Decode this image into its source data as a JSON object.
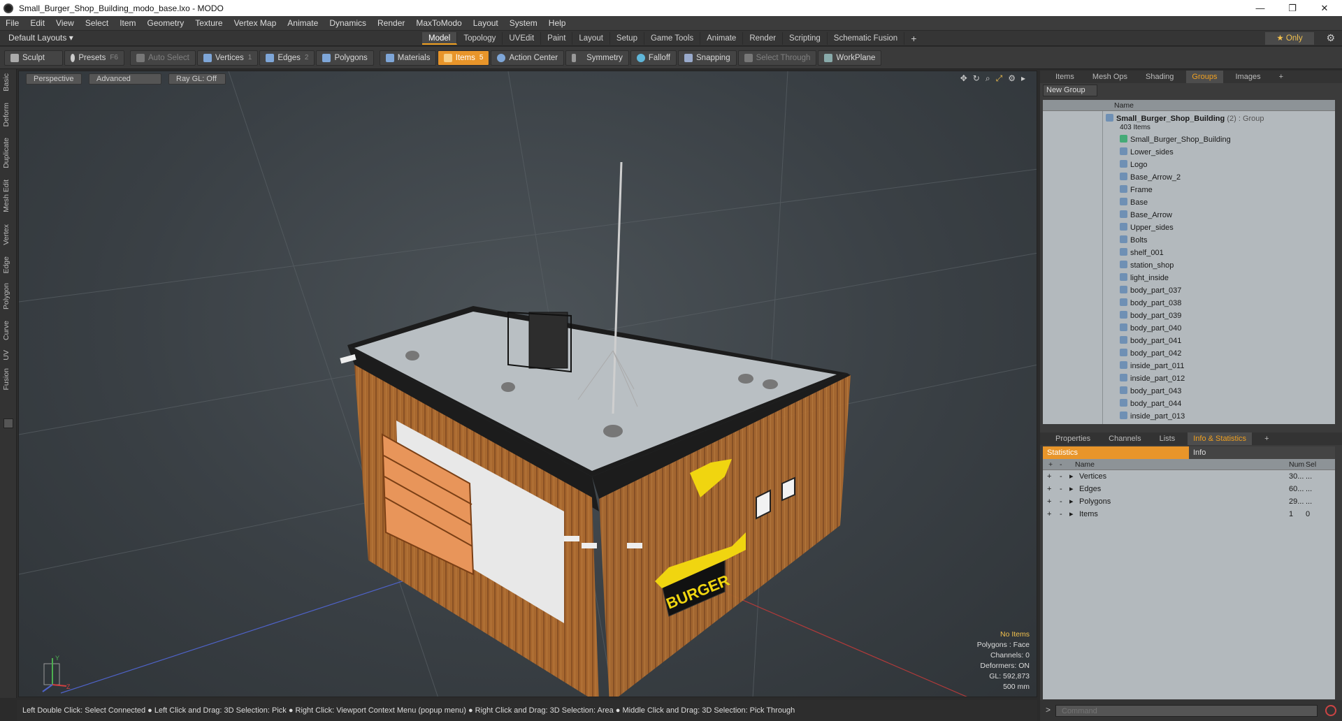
{
  "window": {
    "title": "Small_Burger_Shop_Building_modo_base.lxo - MODO",
    "controls": [
      "—",
      "❐",
      "✕"
    ]
  },
  "menu": [
    "File",
    "Edit",
    "View",
    "Select",
    "Item",
    "Geometry",
    "Texture",
    "Vertex Map",
    "Animate",
    "Dynamics",
    "Render",
    "MaxToModo",
    "Layout",
    "System",
    "Help"
  ],
  "layouts": {
    "label": "Default Layouts ▾",
    "tabs": [
      "Model",
      "Topology",
      "UVEdit",
      "Paint",
      "Layout",
      "Setup",
      "Game Tools",
      "Animate",
      "Render",
      "Scripting",
      "Schematic Fusion"
    ],
    "active": "Model",
    "add": "+",
    "only": "★  Only"
  },
  "toolbar": {
    "sculpt": "Sculpt",
    "presets": "Presets",
    "presets_key": "F6",
    "auto_select": "Auto Select",
    "vertices": "Vertices",
    "vertices_key": "1",
    "edges": "Edges",
    "edges_key": "2",
    "polygons": "Polygons",
    "materials": "Materials",
    "items": "Items",
    "items_key": "5",
    "action_center": "Action Center",
    "symmetry": "Symmetry",
    "falloff": "Falloff",
    "snapping": "Snapping",
    "select_through": "Select Through",
    "workplane": "WorkPlane"
  },
  "left_tabs": [
    "Basic",
    "Deform",
    "Duplicate",
    "Mesh Edit",
    "Vertex",
    "Edge",
    "Polygon",
    "Curve",
    "UV",
    "Fusion"
  ],
  "viewport": {
    "perspective": "Perspective",
    "advanced": "Advanced",
    "raygl": "Ray GL: Off",
    "sign_text": "BURGER",
    "info": {
      "items": "No Items",
      "polygons": "Polygons : Face",
      "channels": "Channels: 0",
      "deformers": "Deformers: ON",
      "gl": "GL: 592,873",
      "scale": "500 mm"
    },
    "axis": {
      "y": "Y",
      "z": "Z"
    }
  },
  "status": "Left Double Click: Select Connected ● Left Click and Drag: 3D Selection: Pick ● Right Click: Viewport Context Menu (popup menu) ● Right Click and Drag: 3D Selection: Area ● Middle Click and Drag: 3D Selection: Pick Through",
  "top_panel": {
    "tabs": [
      "Items",
      "Mesh Ops",
      "Shading",
      "Groups",
      "Images"
    ],
    "active": "Groups",
    "add": "+",
    "new_group": "New Group",
    "name_col": "Name",
    "root": {
      "name": "Small_Burger_Shop_Building",
      "count": "(2)",
      "type": ": Group",
      "sub": "403 Items"
    },
    "items": [
      "Small_Burger_Shop_Building",
      "Lower_sides",
      "Logo",
      "Base_Arrow_2",
      "Frame",
      "Base",
      "Base_Arrow",
      "Upper_sides",
      "Bolts",
      "shelf_001",
      "station_shop",
      "light_inside",
      "body_part_037",
      "body_part_038",
      "body_part_039",
      "body_part_040",
      "body_part_041",
      "body_part_042",
      "inside_part_011",
      "inside_part_012",
      "body_part_043",
      "body_part_044",
      "inside_part_013"
    ]
  },
  "bottom_panel": {
    "tabs": [
      "Properties",
      "Channels",
      "Lists",
      "Info & Statistics"
    ],
    "active": "Info & Statistics",
    "add": "+",
    "subtabs": [
      "Statistics",
      "Info"
    ],
    "cols": {
      "name": "Name",
      "num": "Num",
      "sel": "Sel"
    },
    "rows": [
      {
        "name": "Vertices",
        "num": "30...",
        "sel": "..."
      },
      {
        "name": "Edges",
        "num": "60...",
        "sel": "..."
      },
      {
        "name": "Polygons",
        "num": "29...",
        "sel": "..."
      },
      {
        "name": "Items",
        "num": "1",
        "sel": "0"
      }
    ]
  },
  "command": {
    "placeholder": "Command",
    "prompt": ">"
  }
}
